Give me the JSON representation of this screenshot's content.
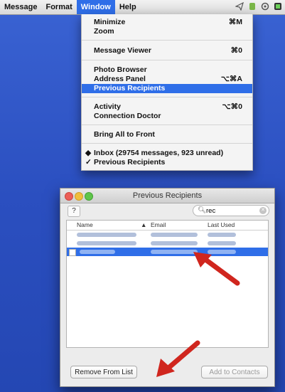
{
  "menubar": {
    "items": [
      "Message",
      "Format",
      "Window",
      "Help"
    ],
    "active_index": 2
  },
  "window_menu": {
    "items": [
      {
        "label": "Minimize",
        "shortcut": "⌘M"
      },
      {
        "label": "Zoom",
        "shortcut": ""
      },
      {
        "label": "Message Viewer",
        "shortcut": "⌘0"
      },
      {
        "label": "Photo Browser",
        "shortcut": ""
      },
      {
        "label": "Address Panel",
        "shortcut": "⌥⌘A"
      },
      {
        "label": "Previous Recipients",
        "shortcut": "",
        "highlighted": true
      },
      {
        "label": "Activity",
        "shortcut": "⌥⌘0"
      },
      {
        "label": "Connection Doctor",
        "shortcut": ""
      },
      {
        "label": "Bring All to Front",
        "shortcut": ""
      },
      {
        "label": "Inbox (29754 messages, 923 unread)",
        "shortcut": "",
        "mark": "◆"
      },
      {
        "label": "Previous Recipients",
        "shortcut": "",
        "mark": "✓"
      }
    ]
  },
  "recipients_window": {
    "title": "Previous Recipients",
    "help_label": "?",
    "search": {
      "value": "rec"
    },
    "columns": [
      "Name",
      "Email",
      "Last Used"
    ],
    "sort_indicator": "▲",
    "rows": [
      {
        "selected": false
      },
      {
        "selected": false
      },
      {
        "selected": true
      }
    ],
    "remove_button": "Remove From List",
    "add_button": "Add to Contacts"
  },
  "colors": {
    "accent": "#2f6ee8",
    "desktop": "#2f55c6",
    "arrow": "#d0261e"
  }
}
